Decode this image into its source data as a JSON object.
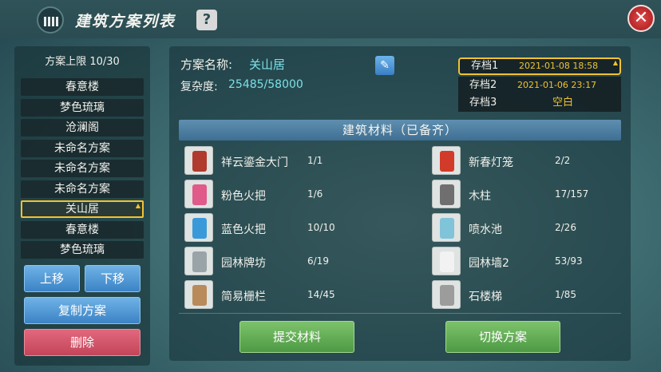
{
  "header": {
    "title": "建筑方案列表",
    "help": "?",
    "close": "✕"
  },
  "left": {
    "limit_label": "方案上限 10/30",
    "plans": [
      "春意楼",
      "梦色琉璃",
      "沧澜阁",
      "未命名方案",
      "未命名方案",
      "未命名方案",
      "关山居",
      "春意楼",
      "梦色琉璃"
    ],
    "selected_index": 6,
    "move_up": "上移",
    "move_down": "下移",
    "copy": "复制方案",
    "delete": "删除"
  },
  "plan": {
    "name_label": "方案名称:",
    "name": "关山居",
    "complexity_label": "复杂度:",
    "complexity": "25485/58000"
  },
  "saves": [
    {
      "name": "存档1",
      "date": "2021-01-08 18:58",
      "selected": true
    },
    {
      "name": "存档2",
      "date": "2021-01-06 23:17",
      "selected": false
    },
    {
      "name": "存档3",
      "date": "空白",
      "selected": false
    }
  ],
  "materials_header": "建筑材料（已备齐）",
  "materials_left": [
    {
      "name": "祥云鎏金大门",
      "count": "1/1",
      "icon": "gate-icon",
      "color": "#b03a2e"
    },
    {
      "name": "粉色火把",
      "count": "1/6",
      "icon": "pink-torch-icon",
      "color": "#e05a8a"
    },
    {
      "name": "蓝色火把",
      "count": "10/10",
      "icon": "blue-torch-icon",
      "color": "#3a9ad9"
    },
    {
      "name": "园林牌坊",
      "count": "6/19",
      "icon": "archway-icon",
      "color": "#9aa3a8"
    },
    {
      "name": "简易栅栏",
      "count": "14/45",
      "icon": "fence-icon",
      "color": "#b98a5a"
    }
  ],
  "materials_right": [
    {
      "name": "新春灯笼",
      "count": "2/2",
      "icon": "lantern-icon",
      "color": "#d23b2a"
    },
    {
      "name": "木柱",
      "count": "17/157",
      "icon": "pillar-icon",
      "color": "#6f6f6f"
    },
    {
      "name": "喷水池",
      "count": "2/26",
      "icon": "fountain-icon",
      "color": "#7fc4d9"
    },
    {
      "name": "园林墙2",
      "count": "53/93",
      "icon": "wall-icon",
      "color": "#f2f2f2"
    },
    {
      "name": "石楼梯",
      "count": "1/85",
      "icon": "stairs-icon",
      "color": "#9c9c9c"
    }
  ],
  "actions": {
    "submit": "提交材料",
    "switch": "切换方案"
  }
}
